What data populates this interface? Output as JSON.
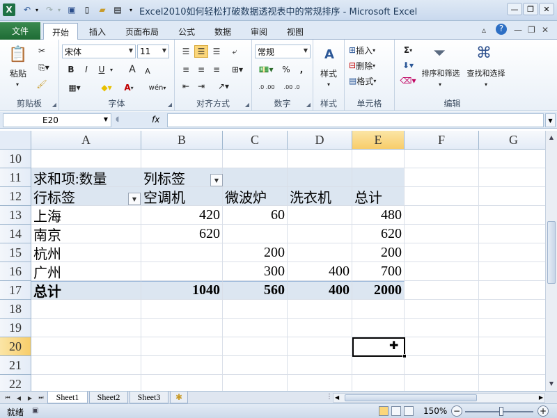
{
  "window": {
    "title": "Excel2010如何轻松打破数据透视表中的常规排序 - Microsoft Excel",
    "app_icon_letter": "X"
  },
  "tabs": [
    {
      "label": "文件"
    },
    {
      "label": "开始"
    },
    {
      "label": "插入"
    },
    {
      "label": "页面布局"
    },
    {
      "label": "公式"
    },
    {
      "label": "数据"
    },
    {
      "label": "审阅"
    },
    {
      "label": "视图"
    }
  ],
  "ribbon": {
    "clipboard": {
      "label": "剪贴板",
      "paste": "粘贴"
    },
    "font": {
      "label": "字体",
      "name": "宋体",
      "size": "11",
      "bold": "B",
      "italic": "I",
      "underline": "U",
      "grow": "A",
      "shrink": "A",
      "font_color": "A",
      "phonetic": "wén"
    },
    "alignment": {
      "label": "对齐方式"
    },
    "number": {
      "label": "数字",
      "format": "常规",
      "percent": "%",
      "comma": ",",
      "inc_decimal": ".0 .00",
      "dec_decimal": ".00 .0"
    },
    "styles": {
      "label": "样式",
      "button": "样式"
    },
    "cells": {
      "label": "单元格",
      "insert": "插入",
      "delete": "删除",
      "format": "格式"
    },
    "editing": {
      "label": "编辑",
      "sum": "Σ",
      "sort_filter": "排序和筛选",
      "find_select": "查找和选择"
    }
  },
  "formula_bar": {
    "name_box": "E20",
    "fx": "fx",
    "formula": ""
  },
  "columns": [
    "A",
    "B",
    "C",
    "D",
    "E",
    "F",
    "G"
  ],
  "selected_column": "E",
  "rows": [
    {
      "num": "10",
      "cells": {}
    },
    {
      "num": "11",
      "cells": {
        "A": "求和项:数量",
        "B": "列标签"
      }
    },
    {
      "num": "12",
      "cells": {
        "A": "行标签",
        "B": "空调机",
        "C": "微波炉",
        "D": "洗衣机",
        "E": "总计"
      }
    },
    {
      "num": "13",
      "cells": {
        "A": "上海",
        "B": "420",
        "C": "60",
        "E": "480"
      }
    },
    {
      "num": "14",
      "cells": {
        "A": "南京",
        "B": "620",
        "E": "620"
      }
    },
    {
      "num": "15",
      "cells": {
        "A": "杭州",
        "C": "200",
        "E": "200"
      }
    },
    {
      "num": "16",
      "cells": {
        "A": "广州",
        "C": "300",
        "D": "400",
        "E": "700"
      }
    },
    {
      "num": "17",
      "cells": {
        "A": "总计",
        "B": "1040",
        "C": "560",
        "D": "400",
        "E": "2000"
      }
    },
    {
      "num": "18",
      "cells": {}
    },
    {
      "num": "19",
      "cells": {}
    },
    {
      "num": "20",
      "cells": {}
    },
    {
      "num": "21",
      "cells": {}
    },
    {
      "num": "22",
      "cells": {}
    }
  ],
  "selected_row": "20",
  "active_cell": "E20",
  "sheets": [
    {
      "name": "Sheet1",
      "active": true
    },
    {
      "name": "Sheet2",
      "active": false
    },
    {
      "name": "Sheet3",
      "active": false
    }
  ],
  "status": {
    "text": "就绪",
    "zoom": "150%",
    "zoom_minus": "−",
    "zoom_plus": "+"
  },
  "colors": {
    "pivot_header": "#dce6f1",
    "selection_header": "#f8cd6a",
    "file_tab": "#1e6b35"
  }
}
